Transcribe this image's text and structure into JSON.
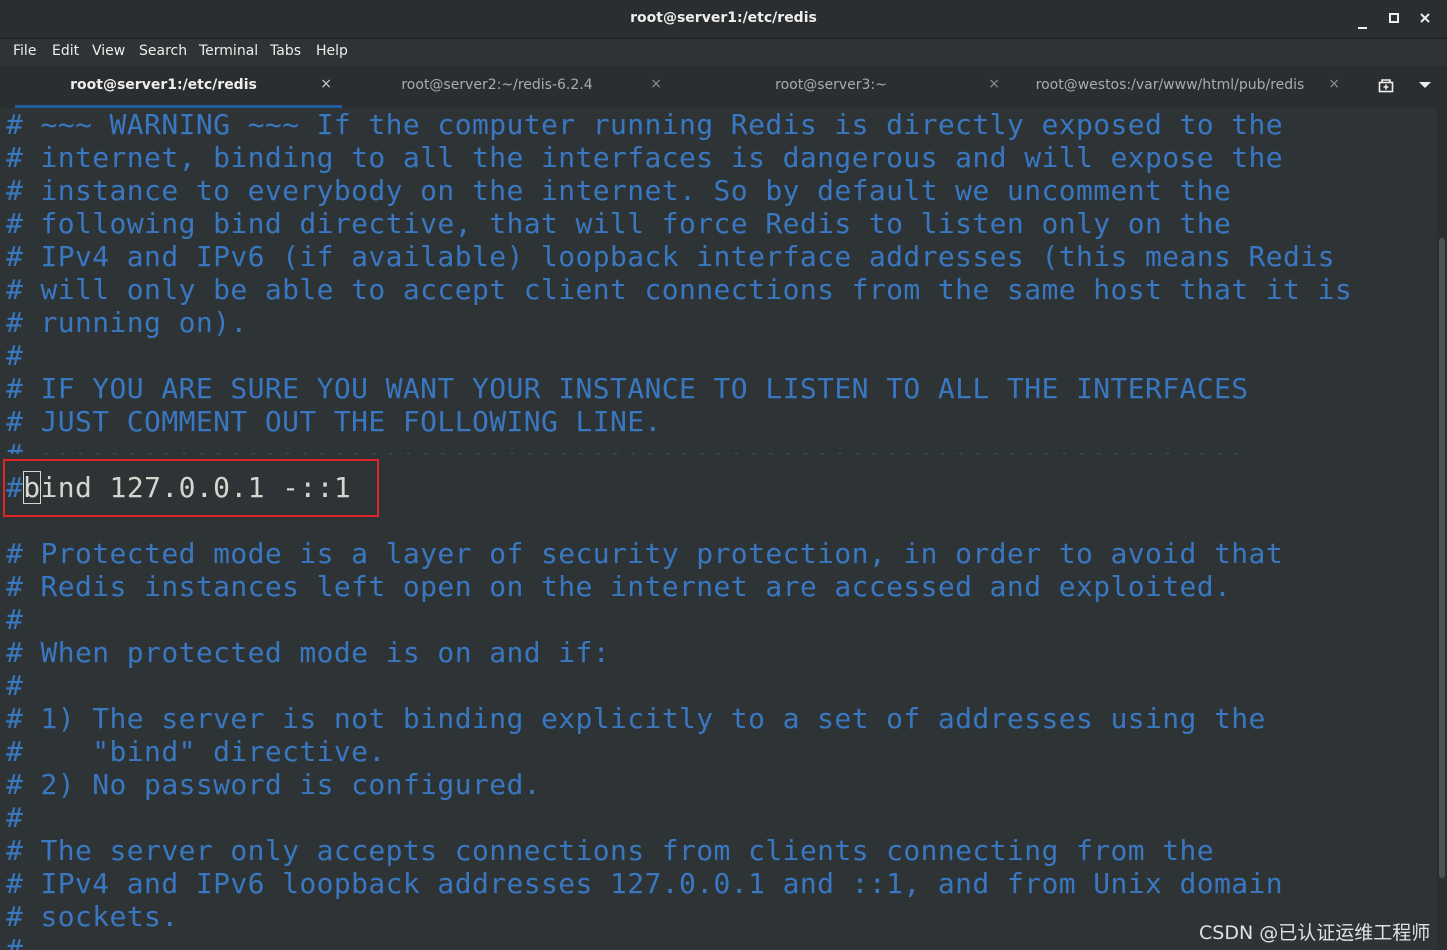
{
  "window": {
    "title": "root@server1:/etc/redis"
  },
  "menu": [
    "File",
    "Edit",
    "View",
    "Search",
    "Terminal",
    "Tabs",
    "Help"
  ],
  "tabs": [
    {
      "label": "root@server1:/etc/redis",
      "active": true
    },
    {
      "label": "root@server2:~/redis-6.2.4",
      "active": false
    },
    {
      "label": "root@server3:~",
      "active": false
    },
    {
      "label": "root@westos:/var/www/html/pub/redis",
      "active": false
    }
  ],
  "terminal": {
    "lines": [
      "# ~~~ WARNING ~~~ If the computer running Redis is directly exposed to the",
      "# internet, binding to all the interfaces is dangerous and will expose the",
      "# instance to everybody on the internet. So by default we uncomment the",
      "# following bind directive, that will force Redis to listen only on the",
      "# IPv4 and IPv6 (if available) loopback interface addresses (this means Redis",
      "# will only be able to accept client connections from the same host that it is",
      "# running on).",
      "#",
      "# IF YOU ARE SURE YOU WANT YOUR INSTANCE TO LISTEN TO ALL THE INTERFACES",
      "# JUST COMMENT OUT THE FOLLOWING LINE.",
      "# ~~~~~~~~~~~~~~~~~~~~~~~~~~~~~~~~~~~~~~~~~~~~~~~~~~~~~~~~~~~~~~~~~~~~~~",
      "#bind 127.0.0.1 -::1",
      "",
      "# Protected mode is a layer of security protection, in order to avoid that",
      "# Redis instances left open on the internet are accessed and exploited.",
      "#",
      "# When protected mode is on and if:",
      "#",
      "# 1) The server is not binding explicitly to a set of addresses using the",
      "#    \"bind\" directive.",
      "# 2) No password is configured.",
      "#",
      "# The server only accepts connections from clients connecting from the",
      "# IPv4 and IPv6 loopback addresses 127.0.0.1 and ::1, and from Unix domain",
      "# sockets.",
      "#"
    ],
    "bind_line": {
      "prefix": "#",
      "cursor_char": "b",
      "rest": "ind 127.0.0.1 -::1"
    },
    "comment_color": "#3a77c1",
    "text_color": "#d3d7cf",
    "highlight_color": "#e0262a"
  },
  "watermark": "CSDN @已认证运维工程师"
}
